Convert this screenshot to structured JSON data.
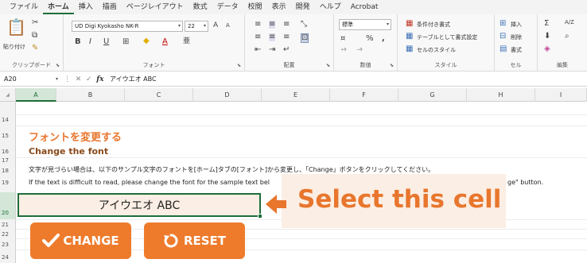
{
  "menu": {
    "tabs": [
      "ファイル",
      "ホーム",
      "挿入",
      "描画",
      "ページレイアウト",
      "数式",
      "データ",
      "校閲",
      "表示",
      "開発",
      "ヘルプ",
      "Acrobat"
    ],
    "active_index": 1
  },
  "ribbon": {
    "clipboard": {
      "label": "クリップボード",
      "paste_label": "貼り付け"
    },
    "font": {
      "label": "フォント",
      "font_name": "UD Digi Kyokasho NK-R",
      "font_size": "22",
      "bold": "B",
      "italic": "I",
      "underline": "U",
      "grow": "A",
      "shrink": "A",
      "color_a": "A",
      "phonetic": "亜"
    },
    "alignment": {
      "label": "配置"
    },
    "number": {
      "label": "数値",
      "format": "標準",
      "percent": "%",
      "comma": ","
    },
    "styles": {
      "label": "スタイル",
      "conditional": "条件付き書式",
      "table": "テーブルとして書式設定",
      "cell_styles": "セルのスタイル"
    },
    "cells": {
      "label": "セル",
      "insert": "挿入",
      "delete": "削除",
      "format": "書式"
    },
    "editing": {
      "label": "編集",
      "sum": "Σ",
      "sort": "A/Z"
    }
  },
  "formula_bar": {
    "name_box": "A20",
    "fx": "fx",
    "content": "アイウエオ ABC"
  },
  "grid": {
    "columns": [
      "A",
      "B",
      "C",
      "D",
      "E",
      "F",
      "G",
      "H",
      "I"
    ],
    "selected_column": "A",
    "rows": [
      "14",
      "15",
      "16",
      "17",
      "18",
      "19",
      "20",
      "21",
      "22",
      "23",
      "24"
    ],
    "selected_row": "20"
  },
  "sheet": {
    "jp_title": "フォントを変更する",
    "en_title": "Change the font",
    "line18": "文字が見づらい場合は、以下のサンプル文字のフォントを[ホーム]タブの[フォント]から変更し、「Change」ボタンをクリックしてください。",
    "line19": "If the text is difficult to read, please change the font for the sample text bel",
    "line19_tail": "ge\" button.",
    "a20_value": "アイウエオ ABC"
  },
  "callout": {
    "text": "Select this cell"
  },
  "buttons": {
    "change_label": "CHANGE",
    "reset_label": "RESET"
  },
  "colors": {
    "accent_orange": "#ee7b2c",
    "excel_green": "#1e6e3a",
    "callout_bg": "#fbeee4"
  }
}
